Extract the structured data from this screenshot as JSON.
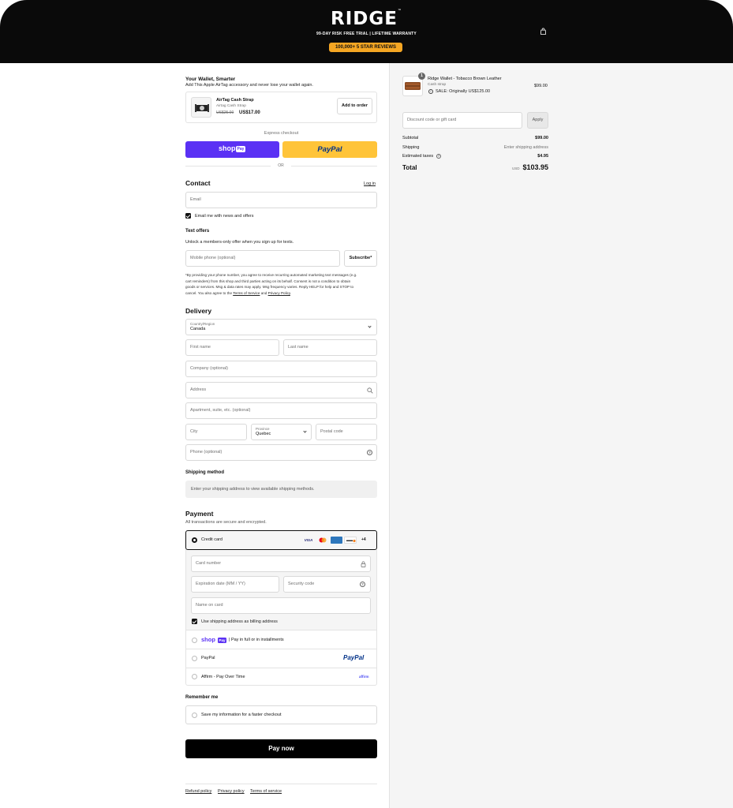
{
  "header": {
    "logo": "RIDGE",
    "trial": "99-DAY RISK FREE TRIAL | LIFETIME WARRANTY",
    "reviews": "100,000+ 5 STAR REVIEWS"
  },
  "upsell": {
    "title": "Your Wallet, Smarter",
    "subtitle": "Add This Apple AirTag accessory and never lose your wallet again.",
    "product_name": "AirTag Cash Strap",
    "product_variant": "Airtag Cash Strap",
    "old_price": "US$25.00",
    "new_price": "US$17.00",
    "add_button": "Add to order"
  },
  "express": {
    "label": "Express checkout",
    "shop": "shop",
    "shop_pay": "Pay",
    "paypal": "PayPal",
    "or": "OR"
  },
  "contact": {
    "title": "Contact",
    "login": "Log in",
    "email_placeholder": "Email",
    "news_label": "Email me with news and offers"
  },
  "text_offers": {
    "title": "Text offers",
    "subtitle": "Unlock a members-only offer when you sign up for texts.",
    "phone_placeholder": "Mobile phone (optional)",
    "subscribe": "Subscribe*",
    "disclaimer_1": "*By providing your phone number, you agree to receive recurring automated marketing text messages (e.g.",
    "disclaimer_2": "cart reminders) from this shop and third parties acting on its behalf. Consent is not a condition to obtain",
    "disclaimer_3": "goods or services. Msg & data rates may apply. Msg frequency varies. Reply HELP for help and STOP to",
    "disclaimer_4a": "cancel. You also agree to the ",
    "terms_link": "Terms of Service",
    "and": " and ",
    "privacy_link": "Privacy Policy",
    "period": "."
  },
  "delivery": {
    "title": "Delivery",
    "country_label": "Country/Region",
    "country_value": "Canada",
    "first_name": "First name",
    "last_name": "Last name",
    "company": "Company (optional)",
    "address": "Address",
    "apartment": "Apartment, suite, etc. (optional)",
    "city": "City",
    "province_label": "Province",
    "province_value": "Quebec",
    "postal": "Postal code",
    "phone": "Phone (optional)"
  },
  "shipping_method": {
    "title": "Shipping method",
    "notice": "Enter your shipping address to view available shipping methods."
  },
  "payment": {
    "title": "Payment",
    "subtitle": "All transactions are secure and encrypted.",
    "credit_card": "Credit card",
    "card_more": "+4",
    "card_number": "Card number",
    "expiration": "Expiration date (MM / YY)",
    "security": "Security code",
    "name_on_card": "Name on card",
    "billing_same": "Use shipping address as billing address",
    "shop_pay_text": "| Pay in full or in installments",
    "paypal": "PayPal",
    "affirm": "Affirm - Pay Over Time",
    "affirm_logo": "affirm"
  },
  "remember": {
    "title": "Remember me",
    "save_label": "Save my information for a faster checkout"
  },
  "pay_button": "Pay now",
  "footer": {
    "refund": "Refund policy",
    "privacy": "Privacy policy",
    "terms": "Terms of service"
  },
  "summary": {
    "qty": "1",
    "item_name": "Ridge Wallet - Tobacco Brown Leather",
    "item_variant": "Cash strap",
    "item_sale": "SALE: Originally US$125.00",
    "item_price": "$99.00",
    "discount_placeholder": "Discount code or gift card",
    "apply": "Apply",
    "subtotal_label": "Subtotal",
    "subtotal": "$99.00",
    "shipping_label": "Shipping",
    "shipping": "Enter shipping address",
    "taxes_label": "Estimated taxes",
    "taxes": "$4.95",
    "total_label": "Total",
    "currency": "USD",
    "total": "$103.95"
  },
  "colors": {
    "header_bg": "#0a0a0a",
    "reviews_pill": "#f5a623",
    "shop_pay": "#5a31f4",
    "paypal_yellow": "#ffc439",
    "paypal_blue": "#003087"
  }
}
